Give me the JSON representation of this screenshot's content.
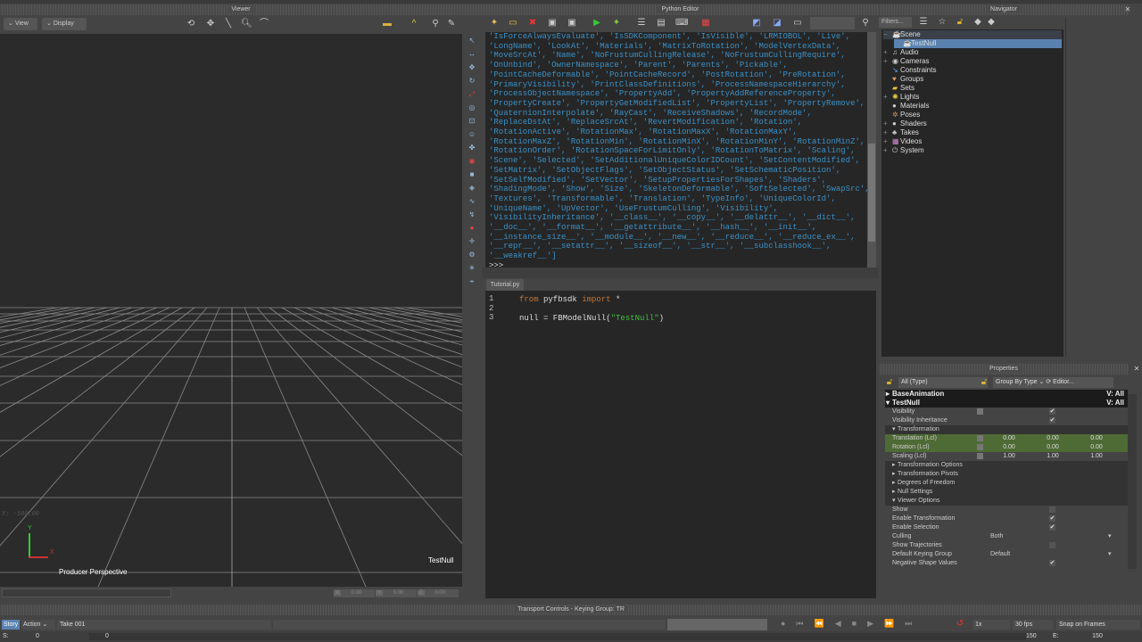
{
  "viewer": {
    "title": "Viewer",
    "view_btn": "View",
    "display_btn": "Display",
    "camera_label": "Producer Perspective",
    "object_label": "TestNull",
    "axis_x": "X",
    "axis_y": "Y",
    "coord_text": "X: -100.00",
    "xyz": [
      {
        "axis": "X",
        "value": "0.00"
      },
      {
        "axis": "Y",
        "value": "0.00"
      },
      {
        "axis": "Z",
        "value": "0.00"
      }
    ]
  },
  "python_editor": {
    "title": "Python Editor",
    "tab": "Tutorial.py",
    "prompt": ">>>",
    "output_lines": [
      "'IsForceAlwaysEvaluate', 'IsSDKComponent', 'IsVisible', 'LRMIOBOL', 'Live',",
      "'LongName', 'LookAt', 'Materials', 'MatrixToRotation', 'ModelVertexData',",
      "'MoveSrcAt', 'Name', 'NoFrustumCullingRelease', 'NoFrustumCullingRequire',",
      "'OnUnbind', 'OwnerNamespace', 'Parent', 'Parents', 'Pickable',",
      "'PointCacheDeformable', 'PointCacheRecord', 'PostRotation', 'PreRotation',",
      "'PrimaryVisibility', 'PrintClassDefinitions', 'ProcessNamespaceHierarchy',",
      "'ProcessObjectNamespace', 'PropertyAdd', 'PropertyAddReferenceProperty',",
      "'PropertyCreate', 'PropertyGetModifiedList', 'PropertyList', 'PropertyRemove',",
      "'QuaternionInterpolate', 'RayCast', 'ReceiveShadows', 'RecordMode',",
      "'ReplaceDstAt', 'ReplaceSrcAt', 'RevertModification', 'Rotation',",
      "'RotationActive', 'RotationMax', 'RotationMaxX', 'RotationMaxY',",
      "'RotationMaxZ', 'RotationMin', 'RotationMinX', 'RotationMinY', 'RotationMinZ',",
      "'RotationOrder', 'RotationSpaceForLimitOnly', 'RotationToMatrix', 'Scaling',",
      "'Scene', 'Selected', 'SetAdditionalUniqueColorIDCount', 'SetContentModified',",
      "'SetMatrix', 'SetObjectFlags', 'SetObjectStatus', 'SetSchematicPosition',",
      "'SetSelfModified', 'SetVector', 'SetupPropertiesForShapes', 'Shaders',",
      "'ShadingMode', 'Show', 'Size', 'SkeletonDeformable', 'SoftSelected', 'SwapSrc',",
      "'Textures', 'Transformable', 'Translation', 'TypeInfo', 'UniqueColorId',",
      "'UniqueName', 'UpVector', 'UseFrustumCulling', 'Visibility',",
      "'VisibilityInheritance', '__class__', '__copy__', '__delattr__', '__dict__',",
      "'__doc__', '__format__', '__getattribute__', '__hash__', '__init__',",
      "'__instance_size__', '__module__', '__new__', '__reduce__', '__reduce_ex__',",
      "'__repr__', '__setattr__', '__sizeof__', '__str__', '__subclasshook__',",
      "'__weakref__']"
    ],
    "line_numbers": [
      "1",
      "2",
      "3"
    ],
    "code": {
      "l1_kw1": "from",
      "l1_mod": " pyfbsdk ",
      "l1_kw2": "import",
      "l1_rest": " *",
      "l3_a": "null = FBModelNull(",
      "l3_str": "\"TestNull\"",
      "l3_b": ")"
    }
  },
  "navigator": {
    "title": "Navigator",
    "filters": "Filters...",
    "items": [
      "Scene",
      "TestNull",
      "Audio",
      "Cameras",
      "Constraints",
      "Groups",
      "Sets",
      "Lights",
      "Materials",
      "Poses",
      "Shaders",
      "Takes",
      "Videos",
      "System"
    ]
  },
  "properties": {
    "title": "Properties",
    "filter": "All (Type)",
    "group_by": "Group By Type",
    "editor": "Editor...",
    "base_animation": "BaseAnimation",
    "v_all": "V: All",
    "test_null": "TestNull",
    "visibility": "Visibility",
    "visibility_inheritance": "Visibility Inheritance",
    "transformation": "Transformation",
    "translation": {
      "label": "Translation (Lcl)",
      "values": [
        "0.00",
        "0.00",
        "0.00"
      ]
    },
    "rotation": {
      "label": "Rotation (Lcl)",
      "values": [
        "0.00",
        "0.00",
        "0.00"
      ]
    },
    "scaling": {
      "label": "Scaling (Lcl)",
      "values": [
        "1.00",
        "1.00",
        "1.00"
      ]
    },
    "sections": [
      "Transformation Options",
      "Transformation Pivots",
      "Degrees of Freedom",
      "Null Settings"
    ],
    "viewer_options": "Viewer Options",
    "show": "Show",
    "enable_transformation": "Enable Transformation",
    "enable_selection": "Enable Selection",
    "culling": "Culling",
    "culling_value": "Both",
    "show_trajectories": "Show Trajectories",
    "default_keying_group": "Default Keying Group",
    "keying_value": "Default",
    "negative_shape_values": "Negative Shape Values"
  },
  "transport": {
    "title": "Transport Controls  -  Keying Group: TR",
    "story": "Story",
    "action": "Action",
    "take": "Take 001",
    "speed": "1x",
    "fps": "30 fps",
    "snap": "Snap on Frames",
    "start_label": "S:",
    "start": "0",
    "end_label": "E:",
    "end": "150",
    "cur_start": "0",
    "cur_end": "150"
  }
}
